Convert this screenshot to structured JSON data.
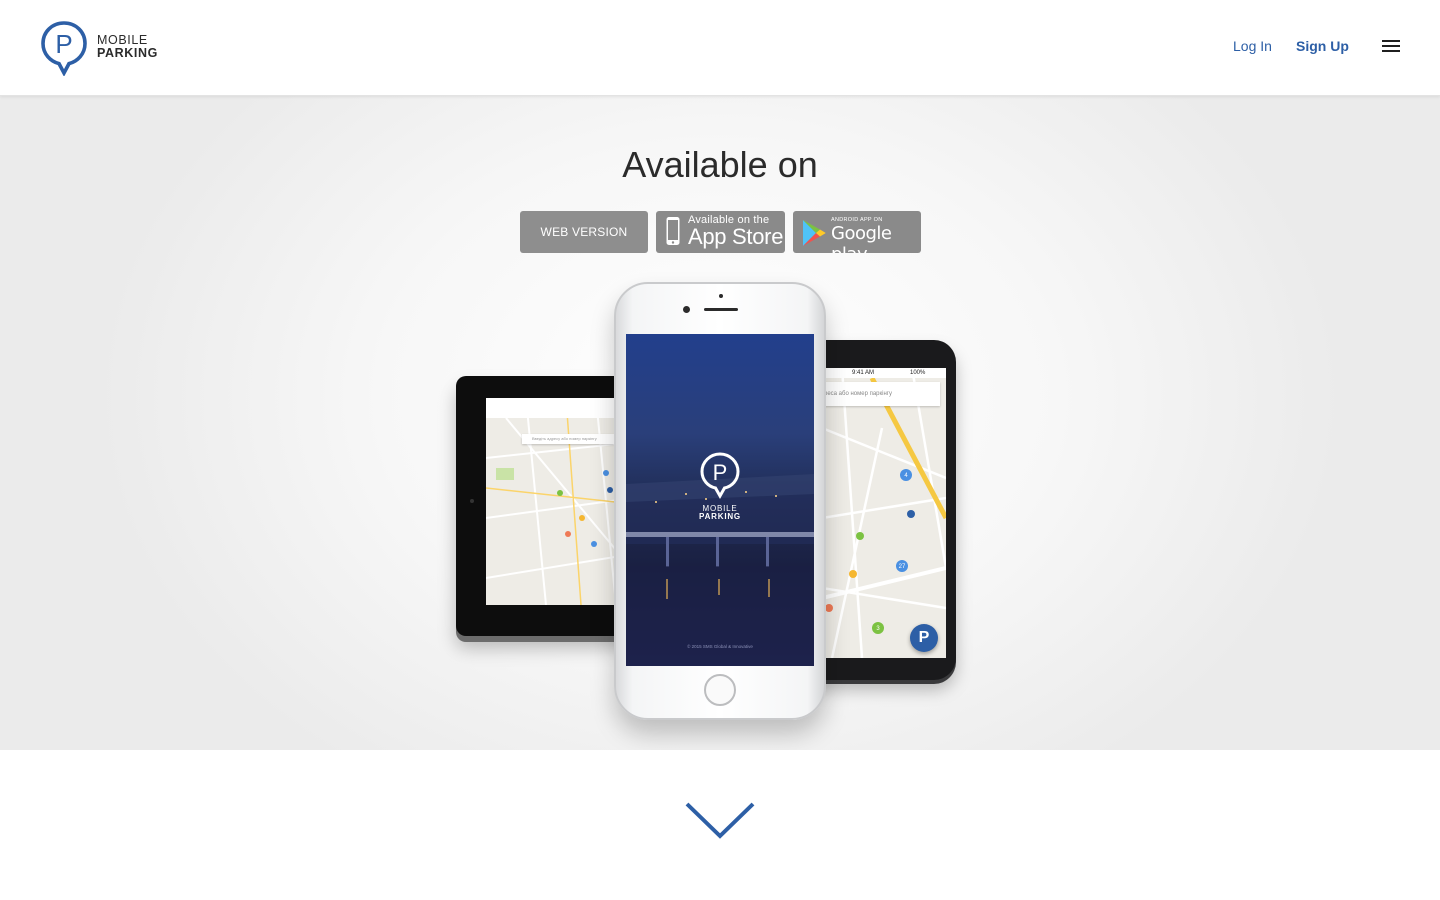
{
  "brand": {
    "line1": "MOBILE",
    "line2": "PARKING",
    "logo_letter": "P",
    "color": "#2d5fa6"
  },
  "nav": {
    "login_label": "Log In",
    "signup_label": "Sign Up",
    "menu_icon": "hamburger-icon"
  },
  "hero": {
    "title": "Available on",
    "buttons": {
      "web_label": "WEB VERSION",
      "appstore_small": "Available on the",
      "appstore_big": "App Store",
      "googleplay_small": "ANDROID APP ON",
      "googleplay_big": "Google play"
    }
  },
  "devices": {
    "tablet_search_placeholder": "Введіть адресу або номер паркінгу",
    "android_status_time": "9:41 AM",
    "android_status_battery": "100%",
    "android_search_placeholder": "реса або номер паркінгу",
    "android_fab": "P",
    "map_badges": [
      "4",
      "27",
      "3"
    ],
    "splash_line1": "MOBILE",
    "splash_line2": "PARKING",
    "splash_copyright": "© 2015 SMS Global & Innovative"
  },
  "footer": {
    "scroll_icon": "chevron-down-icon"
  }
}
